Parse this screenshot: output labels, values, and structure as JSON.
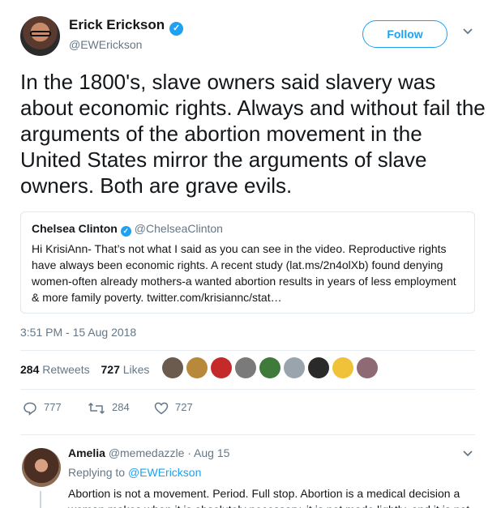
{
  "tweet": {
    "author_name": "Erick Erickson",
    "author_handle": "@EWErickson",
    "follow_label": "Follow",
    "text": "In the 1800's, slave owners said slavery was about economic rights.  Always and without fail the arguments of the abortion movement in the United States mirror the arguments of slave owners.  Both are grave evils.",
    "timestamp": "3:51 PM - 15 Aug 2018",
    "retweets_count": "284",
    "retweets_label": "Retweets",
    "likes_count": "727",
    "likes_label": "Likes"
  },
  "quote": {
    "author_name": "Chelsea Clinton",
    "author_handle": "@ChelseaClinton",
    "text": "Hi KrisiAnn- That’s not what I said as you can see in the video. Reproductive rights have always been economic rights. A recent study (lat.ms/2n4olXb) found denying women-often already mothers-a wanted abortion results in years of less employment & more family poverty. twitter.com/krisiannc/stat…"
  },
  "actions": {
    "replies": "777",
    "retweets": "284",
    "likes": "727"
  },
  "likers": [
    {
      "color": "#6b5a4e"
    },
    {
      "color": "#b8893a"
    },
    {
      "color": "#c42a2a"
    },
    {
      "color": "#7a7a7a"
    },
    {
      "color": "#3f7a3a"
    },
    {
      "color": "#9aa4ad"
    },
    {
      "color": "#2a2a2a"
    },
    {
      "color": "#f0c23a"
    },
    {
      "color": "#8e6a74"
    }
  ],
  "reply": {
    "author_name": "Amelia",
    "author_handle": "@memedazzle · Aug 15",
    "replying_prefix": "Replying to ",
    "replying_to": "@EWErickson",
    "text": "Abortion is not a movement. Period. Full stop. Abortion is a medical decision a woman makes when it is absolutely necessary, it is not made lightly, and it is not"
  },
  "colors": {
    "accent": "#1da1f2",
    "muted": "#657786",
    "text": "#14171a"
  }
}
